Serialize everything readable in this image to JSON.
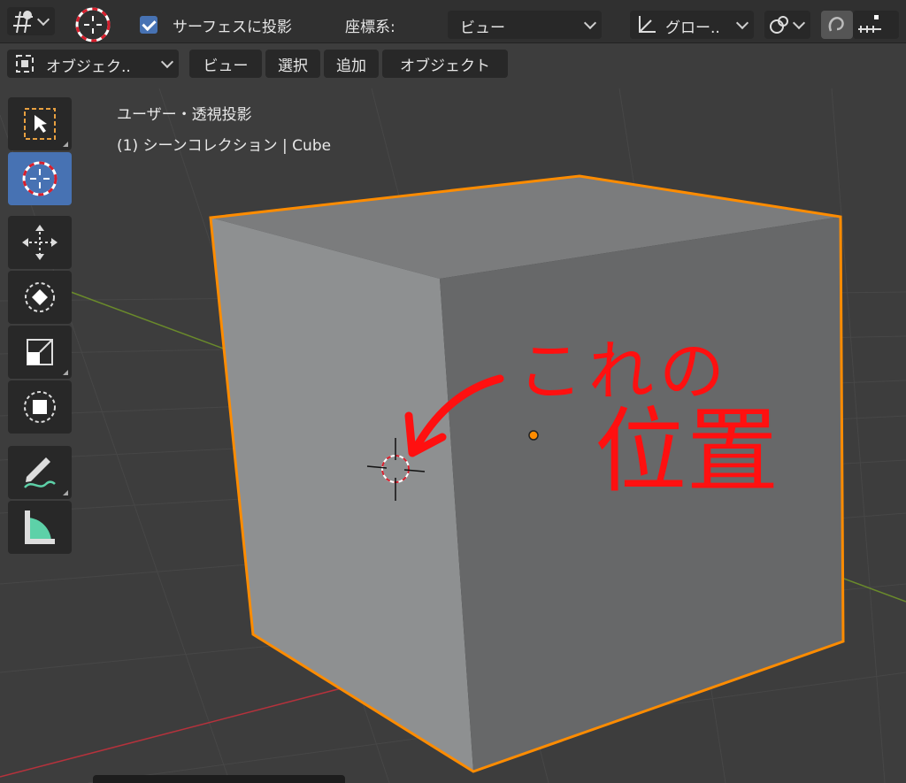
{
  "header": {
    "snap_to_surface_label": "サーフェスに投影",
    "coordinate_label": "座標系:",
    "coordinate_value": "ビュー",
    "orientation_value": "グロー..",
    "snap_to_surface_checked": true
  },
  "menu": {
    "mode": "オブジェク..",
    "view": "ビュー",
    "select": "選択",
    "add": "追加",
    "object": "オブジェクト"
  },
  "viewport_info": {
    "view_name": "ユーザー・透視投影",
    "collection": "(1) シーンコレクション | Cube"
  },
  "annotation": {
    "line1": "これの",
    "line2": "位置"
  },
  "icons": {
    "viewport_gizmo": "gizmo-icon",
    "cursor_tool": "cursor-icon",
    "select_box": "select-box-icon",
    "move": "move-icon",
    "rotate": "rotate-icon",
    "scale": "scale-icon",
    "transform": "transform-icon",
    "annotate": "annotate-icon",
    "measure": "measure-icon",
    "transform_pivot": "pivot-icon",
    "snap": "snap-icon",
    "snap_increment": "increment-icon"
  },
  "colors": {
    "accent_blue": "#4772b3",
    "selection_orange": "#ff8c00",
    "annotation_red": "#ff0000",
    "x_axis": "#b5323c",
    "y_axis": "#6a8a2b"
  }
}
